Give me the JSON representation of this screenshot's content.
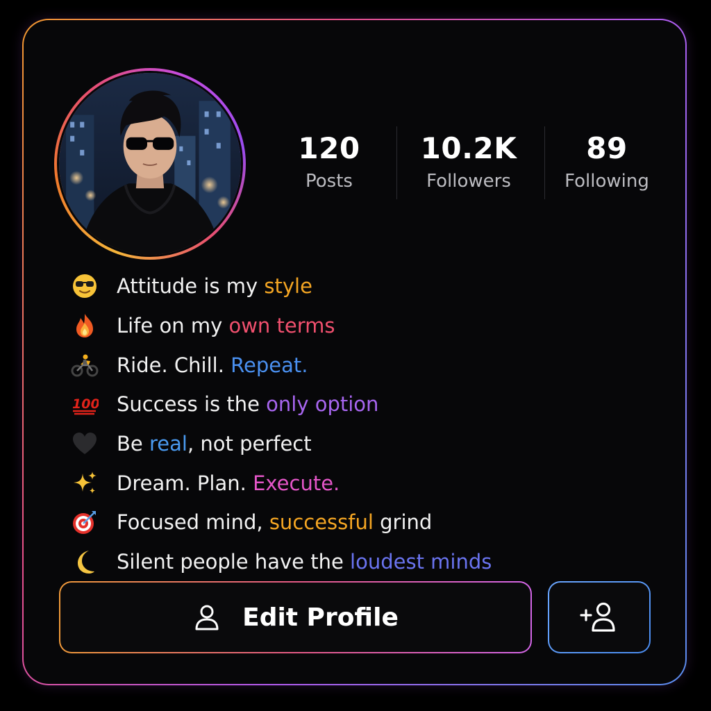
{
  "profile": {
    "avatar_icon": "profile-photo"
  },
  "stats": [
    {
      "value": "120",
      "label": "Posts"
    },
    {
      "value": "10.2K",
      "label": "Followers"
    },
    {
      "value": "89",
      "label": "Following"
    }
  ],
  "bio": [
    {
      "emoji": "sunglasses-face-icon",
      "prefix": "Attitude is my ",
      "highlight": "style",
      "suffix": "",
      "color": "#f5a623"
    },
    {
      "emoji": "fire-icon",
      "prefix": "Life on my ",
      "highlight": "own terms",
      "suffix": "",
      "color": "#f0506e"
    },
    {
      "emoji": "motorcycle-icon",
      "prefix": "Ride. Chill. ",
      "highlight": "Repeat.",
      "suffix": "",
      "color": "#4a90f0"
    },
    {
      "emoji": "hundred-points-icon",
      "prefix": "Success is the ",
      "highlight": "only option",
      "suffix": "",
      "color": "#a866f0"
    },
    {
      "emoji": "black-heart-icon",
      "prefix": "Be ",
      "highlight": "real",
      "suffix": ", not perfect",
      "color": "#4a9af0"
    },
    {
      "emoji": "sparkles-icon",
      "prefix": "Dream. Plan. ",
      "highlight": "Execute.",
      "suffix": "",
      "color": "#e456c8"
    },
    {
      "emoji": "target-icon",
      "prefix": "Focused mind, ",
      "highlight": "successful",
      "suffix": " grind",
      "color": "#f5a623"
    },
    {
      "emoji": "crescent-moon-icon",
      "prefix": "Silent people have the ",
      "highlight": "loudest minds",
      "suffix": "",
      "color": "#6a74f0"
    }
  ],
  "actions": {
    "edit_label": "Edit Profile",
    "edit_icon": "user-icon",
    "add_icon": "add-user-icon"
  },
  "colors": {
    "background": "#000000",
    "card": "#070709",
    "text": "#f2f2f2",
    "muted": "#bdbdc2",
    "gradient_start": "#f29a2e",
    "gradient_mid": "#b45af0",
    "gradient_end": "#5a8ff0"
  }
}
